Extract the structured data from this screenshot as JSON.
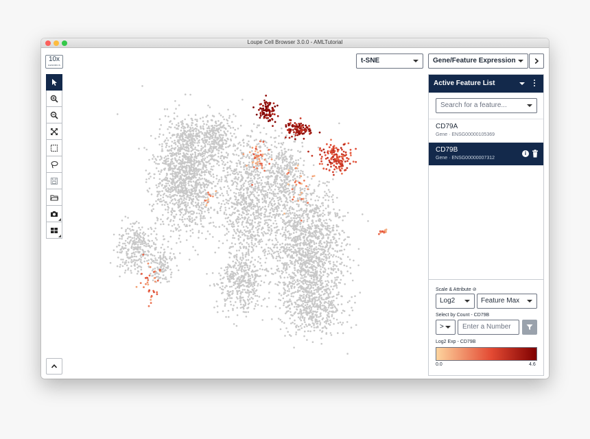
{
  "window": {
    "title": "Loupe Cell Browser 3.0.0 - AMLTutorial"
  },
  "logo": {
    "main": "10x",
    "sub": "GENOMICS"
  },
  "toolbar": {
    "tools": [
      {
        "name": "select-pointer",
        "icon": "arrow-pointer-icon",
        "active": true
      },
      {
        "name": "zoom-in",
        "icon": "zoom-in-icon",
        "active": false
      },
      {
        "name": "zoom-out",
        "icon": "zoom-out-icon",
        "active": false
      },
      {
        "name": "fit-view",
        "icon": "expand-arrows-icon",
        "active": false
      },
      {
        "name": "box-select",
        "icon": "dashed-rectangle-icon",
        "active": false
      },
      {
        "name": "lasso-select",
        "icon": "lasso-icon",
        "active": false
      },
      {
        "name": "save",
        "icon": "floppy-disk-icon",
        "active": false
      },
      {
        "name": "open-folder",
        "icon": "folder-icon",
        "active": false
      },
      {
        "name": "screenshot",
        "icon": "camera-icon",
        "active": false
      },
      {
        "name": "layout",
        "icon": "grid-icon",
        "active": false
      }
    ],
    "collapse_icon": "chevron-up-icon"
  },
  "header": {
    "projection": "t-SNE",
    "mode": "Gene/Feature Expression",
    "next_icon": "chevron-right-icon"
  },
  "panel": {
    "title": "Active Feature List",
    "search_placeholder": "Search for a feature...",
    "features": [
      {
        "name": "CD79A",
        "sub": "Gene · ENSG00000105369",
        "selected": false
      },
      {
        "name": "CD79B",
        "sub": "Gene · ENSG00000007312",
        "selected": true
      }
    ],
    "scale_label": "Scale & Attribute ⊘",
    "scale": "Log2",
    "attribute": "Feature Max",
    "count_label": "Select by Count - CD79B",
    "operator": ">",
    "number_placeholder": "Enter a Number",
    "gradient_label": "Log2 Exp - CD79B",
    "gradient_min": "0.0",
    "gradient_max": "4.6",
    "colors": {
      "low": "#fdd49e",
      "mid": "#e34a33",
      "high": "#7f0000",
      "header": "#13294b",
      "cell": "#c8c8c8"
    }
  }
}
